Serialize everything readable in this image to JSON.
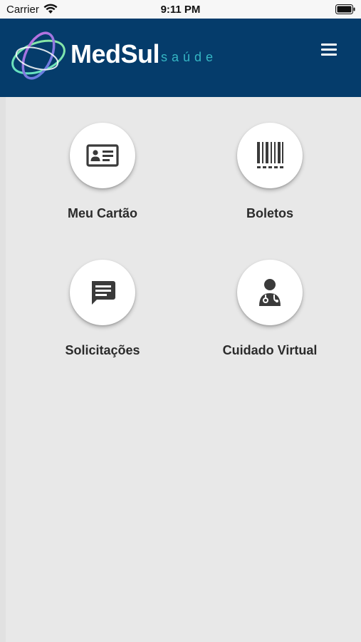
{
  "status_bar": {
    "carrier": "Carrier",
    "time": "9:11 PM"
  },
  "header": {
    "brand": "MedSul",
    "tagline": "saúde",
    "menu_icon": "hamburger-menu-icon",
    "background_color": "#053c6b"
  },
  "menu_tiles": [
    {
      "label": "Meu Cartão",
      "icon": "id-card-icon"
    },
    {
      "label": "Boletos",
      "icon": "barcode-icon"
    },
    {
      "label": "Solicitações",
      "icon": "message-icon"
    },
    {
      "label": "Cuidado Virtual",
      "icon": "doctor-icon"
    }
  ],
  "colors": {
    "icon": "#3a3a3a",
    "background": "#e8e8e8",
    "accent": "#35b6c4"
  }
}
